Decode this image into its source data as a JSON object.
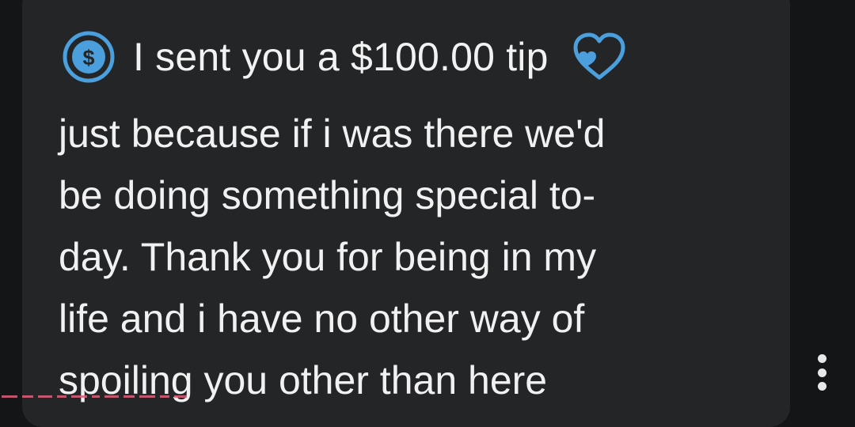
{
  "tip": {
    "title": "I sent you a $100.00 tip",
    "icon": "dollar-circle-icon",
    "reaction_icon": "heart-outline-icon",
    "accent_color": "#4a9fdc"
  },
  "message": {
    "lines": [
      "just because if i was there we'd",
      "be doing something special to-",
      "day. Thank you for being in my",
      "life and i have no other way of",
      "spoiling you other than here"
    ]
  },
  "menu": {
    "icon": "more-vertical-icon"
  },
  "colors": {
    "background": "#141516",
    "bubble": "#232527",
    "text": "#f1f1f1",
    "watermark": "#e0607a"
  }
}
